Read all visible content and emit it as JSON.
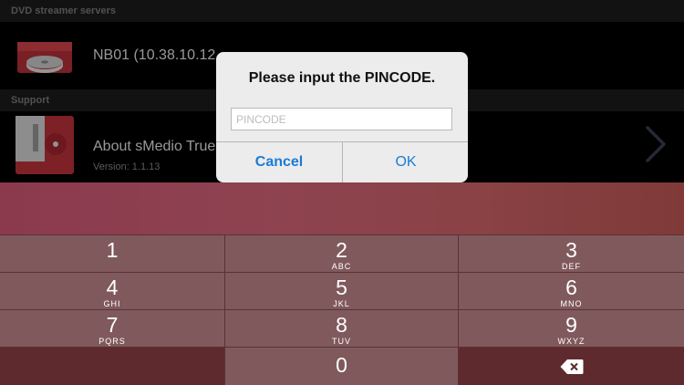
{
  "servers_section": {
    "header": "DVD streamer servers"
  },
  "server": {
    "name": "NB01 (10.38.10.12"
  },
  "support_section": {
    "header": "Support"
  },
  "about": {
    "title": "About sMedio True",
    "version": "Version: 1.1.13"
  },
  "dialog": {
    "title": "Please input the PINCODE.",
    "input_value": "",
    "input_placeholder": "PINCODE",
    "cancel_label": "Cancel",
    "ok_label": "OK"
  },
  "keypad": {
    "k1": {
      "num": "1",
      "letters": ""
    },
    "k2": {
      "num": "2",
      "letters": "ABC"
    },
    "k3": {
      "num": "3",
      "letters": "DEF"
    },
    "k4": {
      "num": "4",
      "letters": "GHI"
    },
    "k5": {
      "num": "5",
      "letters": "JKL"
    },
    "k6": {
      "num": "6",
      "letters": "MNO"
    },
    "k7": {
      "num": "7",
      "letters": "PQRS"
    },
    "k8": {
      "num": "8",
      "letters": "TUV"
    },
    "k9": {
      "num": "9",
      "letters": "WXYZ"
    },
    "k0": {
      "num": "0",
      "letters": ""
    },
    "delete_icon": "delete-backspace-icon"
  },
  "colors": {
    "app_icon_red": "#c0343c",
    "dialog_button_blue": "#1a7bd9",
    "key_face": "#80595d",
    "key_dark": "#5e2a2e"
  }
}
